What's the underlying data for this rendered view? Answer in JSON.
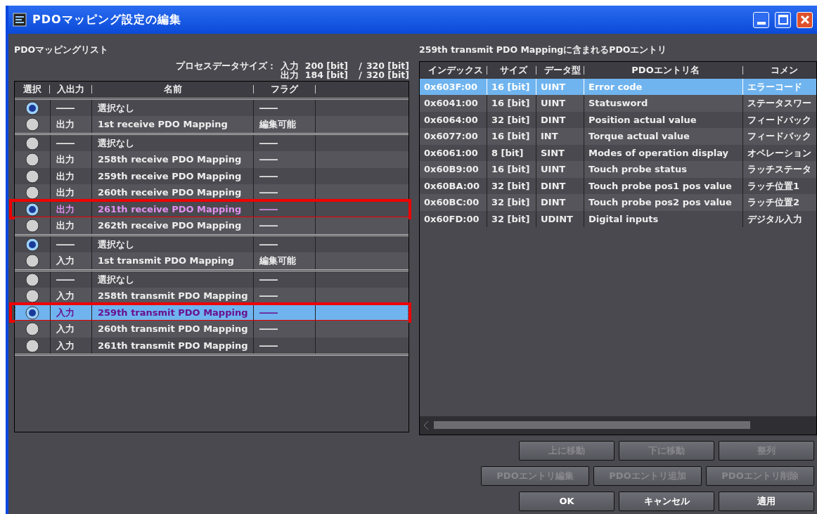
{
  "window": {
    "title": "PDOマッピング設定の編集"
  },
  "mapping_list": {
    "title": "PDOマッピングリスト",
    "size_label": "プロセスデータサイズ：",
    "size_lines": [
      {
        "direction": "入力",
        "used": "200 [bit]",
        "separator": "/",
        "max": "320 [bit]"
      },
      {
        "direction": "出力",
        "used": "184 [bit]",
        "separator": "/",
        "max": "320 [bit]"
      }
    ],
    "columns": [
      "選択",
      "入出力",
      "名前",
      "フラグ"
    ],
    "groups": [
      {
        "rows": [
          {
            "selected": true,
            "changed": false,
            "focused": false,
            "annotated": false,
            "io": "――",
            "name": "選択なし",
            "flag": "――"
          },
          {
            "selected": false,
            "changed": false,
            "focused": false,
            "annotated": false,
            "io": "出力",
            "name": "1st receive PDO Mapping",
            "flag": "編集可能"
          }
        ]
      },
      {
        "rows": [
          {
            "selected": false,
            "changed": false,
            "focused": false,
            "annotated": false,
            "io": "――",
            "name": "選択なし",
            "flag": "――"
          },
          {
            "selected": false,
            "changed": false,
            "focused": false,
            "annotated": false,
            "io": "出力",
            "name": "258th receive PDO Mapping",
            "flag": "――"
          },
          {
            "selected": false,
            "changed": false,
            "focused": false,
            "annotated": false,
            "io": "出力",
            "name": "259th receive PDO Mapping",
            "flag": "――"
          },
          {
            "selected": false,
            "changed": false,
            "focused": false,
            "annotated": false,
            "io": "出力",
            "name": "260th receive PDO Mapping",
            "flag": "――"
          },
          {
            "selected": true,
            "changed": true,
            "focused": false,
            "annotated": true,
            "io": "出力",
            "name": "261th receive PDO Mapping",
            "flag": "――"
          },
          {
            "selected": false,
            "changed": false,
            "focused": false,
            "annotated": false,
            "io": "出力",
            "name": "262th receive PDO Mapping",
            "flag": "――"
          }
        ]
      },
      {
        "rows": [
          {
            "selected": true,
            "changed": false,
            "focused": false,
            "annotated": false,
            "io": "――",
            "name": "選択なし",
            "flag": "――"
          },
          {
            "selected": false,
            "changed": false,
            "focused": false,
            "annotated": false,
            "io": "入力",
            "name": "1st transmit PDO Mapping",
            "flag": "編集可能"
          }
        ]
      },
      {
        "rows": [
          {
            "selected": false,
            "changed": false,
            "focused": false,
            "annotated": false,
            "io": "――",
            "name": "選択なし",
            "flag": "――"
          },
          {
            "selected": false,
            "changed": false,
            "focused": false,
            "annotated": false,
            "io": "入力",
            "name": "258th transmit PDO Mapping",
            "flag": "――"
          },
          {
            "selected": true,
            "changed": true,
            "focused": true,
            "annotated": true,
            "io": "入力",
            "name": "259th transmit PDO Mapping",
            "flag": "――"
          },
          {
            "selected": false,
            "changed": false,
            "focused": false,
            "annotated": false,
            "io": "入力",
            "name": "260th transmit PDO Mapping",
            "flag": "――"
          },
          {
            "selected": false,
            "changed": false,
            "focused": false,
            "annotated": false,
            "io": "入力",
            "name": "261th transmit PDO Mapping",
            "flag": "――"
          }
        ]
      }
    ]
  },
  "entries": {
    "title": "259th transmit PDO Mappingに含まれるPDOエントリ",
    "columns": [
      "インデックス",
      "サイズ",
      "データ型",
      "PDOエントリ名",
      "コメン"
    ],
    "rows": [
      {
        "selected": true,
        "index": "0x603F:00",
        "size": "16 [bit]",
        "type": "UINT",
        "name": "Error code",
        "comment": "エラーコード"
      },
      {
        "selected": false,
        "index": "0x6041:00",
        "size": "16 [bit]",
        "type": "UINT",
        "name": "Statusword",
        "comment": "ステータスワー"
      },
      {
        "selected": false,
        "index": "0x6064:00",
        "size": "32 [bit]",
        "type": "DINT",
        "name": "Position actual value",
        "comment": "フィードバック"
      },
      {
        "selected": false,
        "index": "0x6077:00",
        "size": "16 [bit]",
        "type": "INT",
        "name": "Torque actual value",
        "comment": "フィードバック"
      },
      {
        "selected": false,
        "index": "0x6061:00",
        "size": "8 [bit]",
        "type": "SINT",
        "name": "Modes of operation display",
        "comment": "オペレーション"
      },
      {
        "selected": false,
        "index": "0x60B9:00",
        "size": "16 [bit]",
        "type": "UINT",
        "name": "Touch probe status",
        "comment": "ラッチステータ"
      },
      {
        "selected": false,
        "index": "0x60BA:00",
        "size": "32 [bit]",
        "type": "DINT",
        "name": "Touch probe pos1 pos value",
        "comment": "ラッチ位置1"
      },
      {
        "selected": false,
        "index": "0x60BC:00",
        "size": "32 [bit]",
        "type": "DINT",
        "name": "Touch probe pos2 pos value",
        "comment": "ラッチ位置2"
      },
      {
        "selected": false,
        "index": "0x60FD:00",
        "size": "32 [bit]",
        "type": "UDINT",
        "name": "Digital inputs",
        "comment": "デジタル入力"
      }
    ]
  },
  "button_rows": [
    [
      {
        "label": "上に移動",
        "disabled": true
      },
      {
        "label": "下に移動",
        "disabled": true
      },
      {
        "label": "整列",
        "disabled": true
      }
    ],
    [
      {
        "label": "PDOエントリ編集",
        "disabled": true
      },
      {
        "label": "PDOエントリ追加",
        "disabled": true
      },
      {
        "label": "PDOエントリ削除",
        "disabled": true
      }
    ],
    [
      {
        "label": "OK",
        "disabled": false
      },
      {
        "label": "キャンセル",
        "disabled": false
      },
      {
        "label": "適用",
        "disabled": false
      }
    ]
  ]
}
